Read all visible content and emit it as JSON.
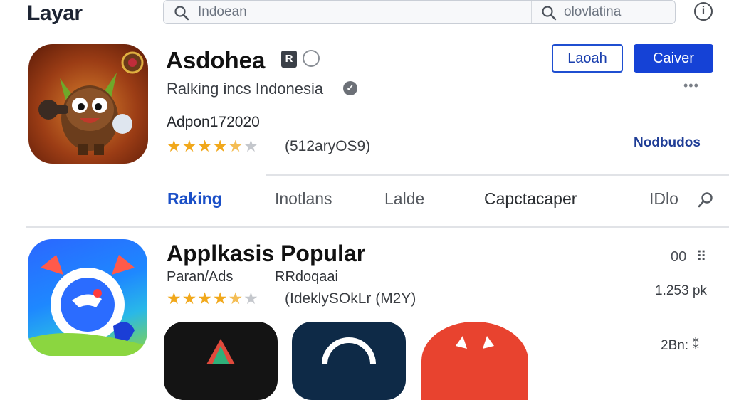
{
  "header": {
    "logo": "Layar",
    "search_left": "Indoean",
    "search_right": "olovlatina",
    "info_label": "i"
  },
  "featured": {
    "title": "Asdohea",
    "badge": "R",
    "subtitle": "Ralking incs Indonesia",
    "developer": "Adpon172020",
    "rating_stars": 4.5,
    "rating_count": "(512aryOS9)",
    "open_button": "Laoah",
    "install_button": "Caiver",
    "more_dots": "•••",
    "side_link": "Nodbudos",
    "icon": "game-mascot-icon"
  },
  "tabs": [
    {
      "label": "Raking",
      "active": true
    },
    {
      "label": "Inotlans",
      "active": false
    },
    {
      "label": "Lalde",
      "active": false
    },
    {
      "label": "Capctacaper",
      "active": false
    },
    {
      "label": "IDlo",
      "active": false
    }
  ],
  "popular": {
    "title": "Applkasis Popular",
    "sub_left": "Paran/Ads",
    "sub_right": "RRdoqaai",
    "rating_stars": 4.5,
    "rating_count": "(IdeklySOkLr (M2Y)",
    "right_top": "00",
    "right_mid": "1.253 pk",
    "right_bottom": "2Bn:",
    "icon": "chat-app-icon"
  },
  "colors": {
    "accent": "#1542d6",
    "star": "#f1a81b",
    "active_tab": "#1a4fc7"
  }
}
